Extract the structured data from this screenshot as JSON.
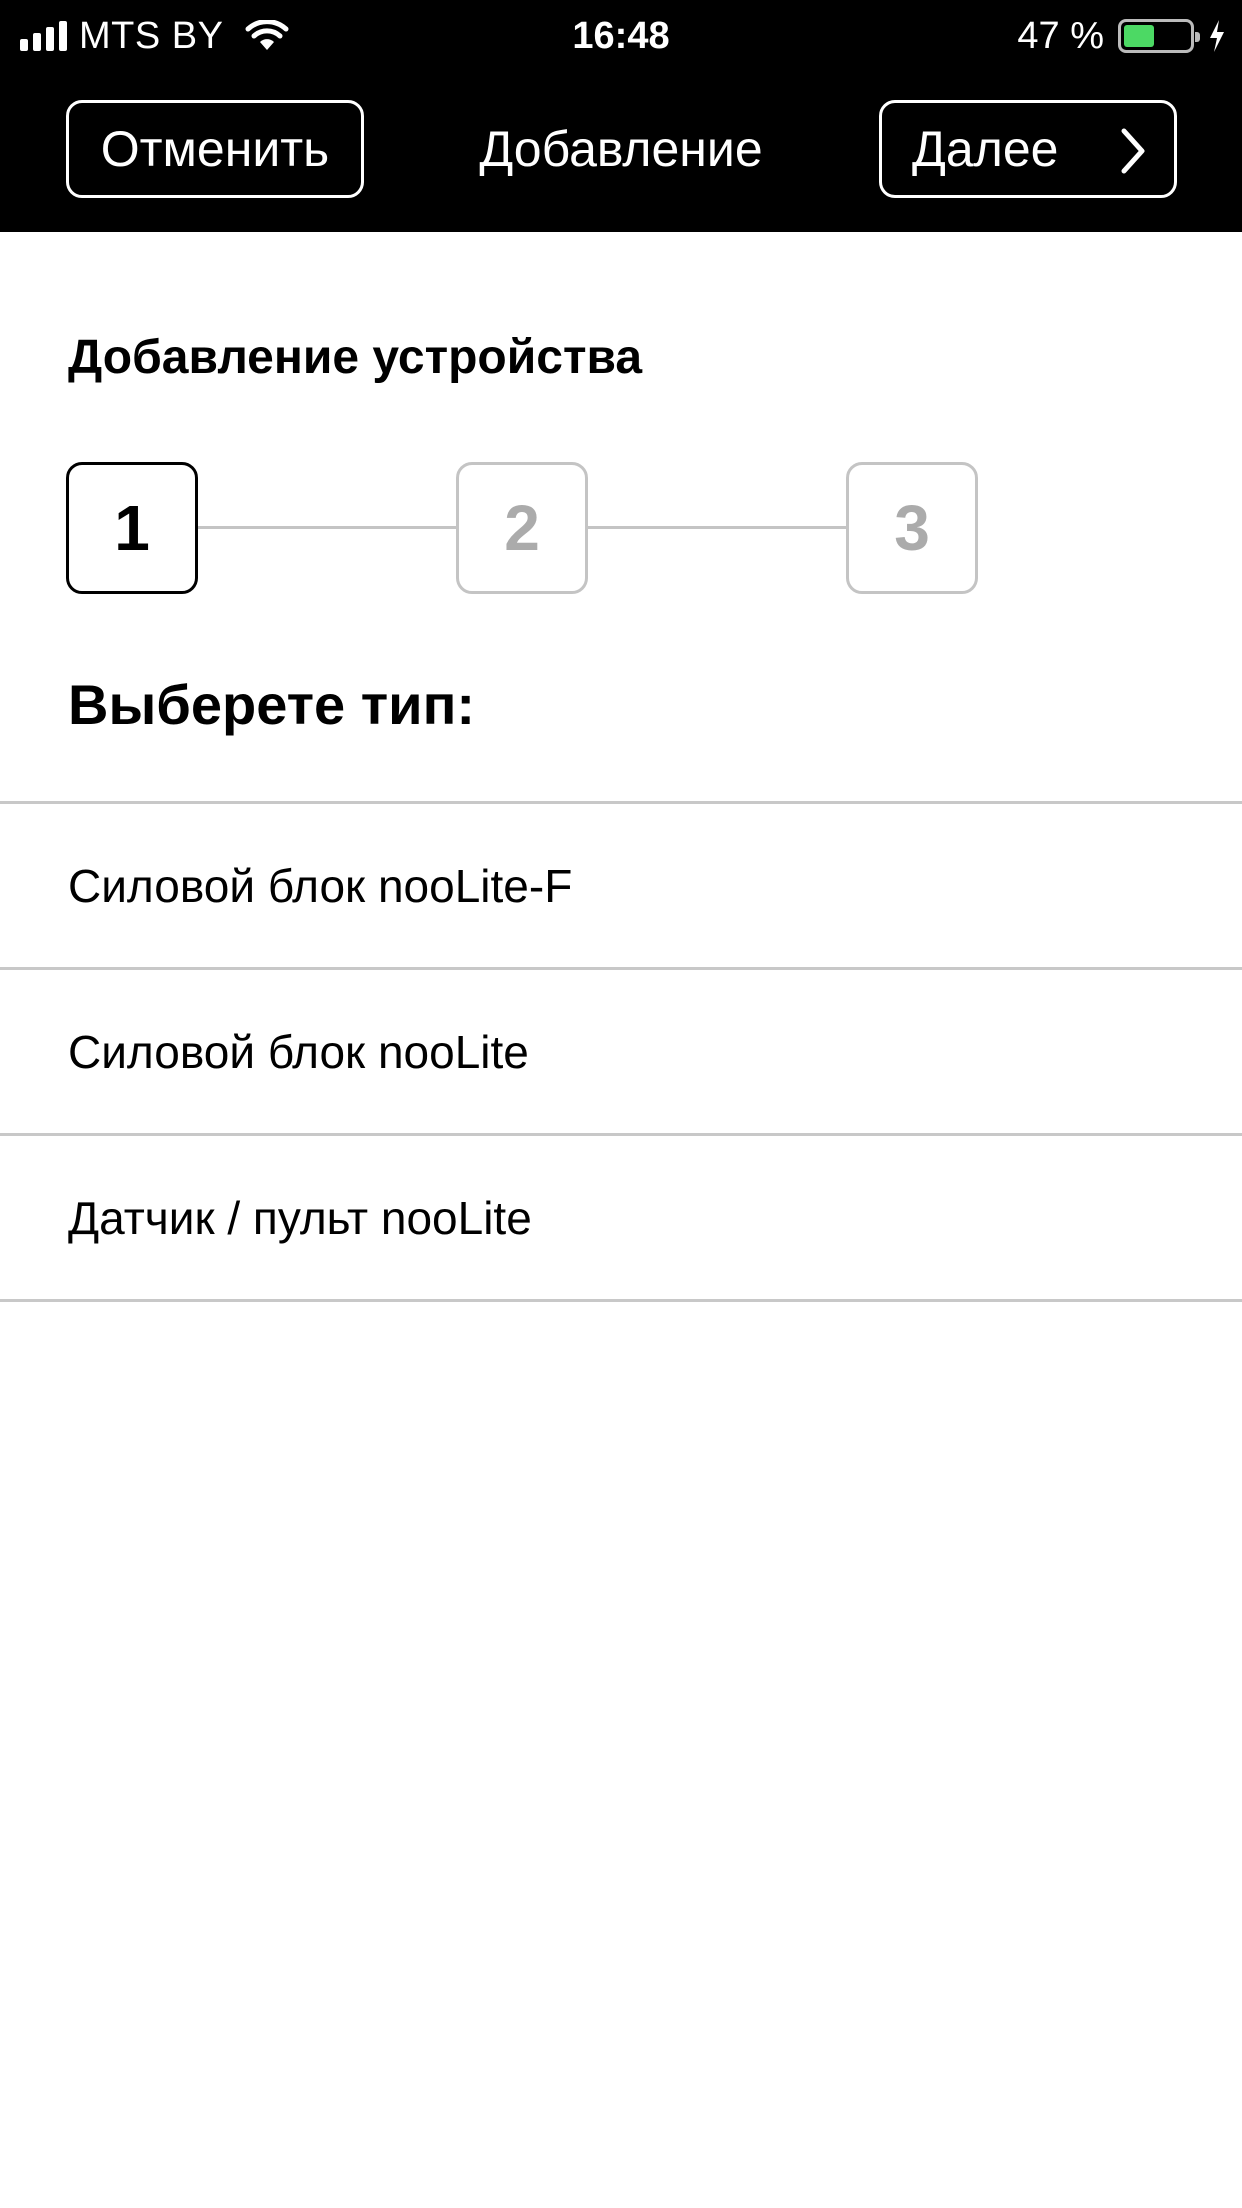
{
  "status_bar": {
    "carrier": "MTS BY",
    "time": "16:48",
    "battery_percent_label": "47 %",
    "battery_level": 0.47,
    "battery_color": "#4cd964",
    "icons": [
      "signal-bars-icon",
      "wifi-icon",
      "battery-icon",
      "charging-bolt-icon"
    ]
  },
  "nav": {
    "cancel_label": "Отменить",
    "title": "Добавление",
    "next_label": "Далее",
    "next_icon": "chevron-right-icon"
  },
  "content": {
    "section_title": "Добавление устройства",
    "steps": [
      {
        "label": "1",
        "state": "active"
      },
      {
        "label": "2",
        "state": "inactive"
      },
      {
        "label": "3",
        "state": "inactive"
      }
    ],
    "choose_label": "Выберете тип:",
    "types": [
      {
        "label": "Силовой блок nooLite-F"
      },
      {
        "label": "Силовой блок nooLite"
      },
      {
        "label": "Датчик / пульт nooLite"
      }
    ]
  },
  "colors": {
    "bar_background": "#000000",
    "page_background": "#ffffff",
    "inactive_step": "#ababab",
    "divider": "#c8c8c8"
  }
}
